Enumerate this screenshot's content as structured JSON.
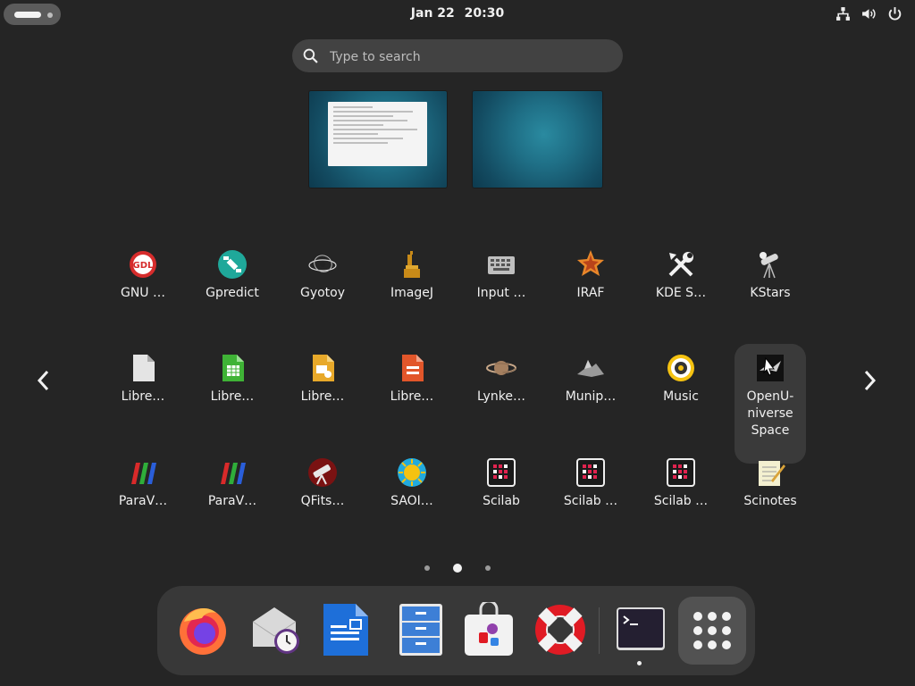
{
  "topbar": {
    "date": "Jan 22",
    "time": "20:30",
    "icons": [
      "network-icon",
      "volume-icon",
      "power-icon"
    ]
  },
  "search": {
    "placeholder": "Type to search"
  },
  "workspaces": [
    "Workspace 1",
    "Workspace 2"
  ],
  "app_grid": {
    "rows": [
      [
        {
          "label": "GNU …",
          "icon": "gdl-icon"
        },
        {
          "label": "Gpredict",
          "icon": "gpredict-icon"
        },
        {
          "label": "Gyotoy",
          "icon": "gyotoy-icon"
        },
        {
          "label": "ImageJ",
          "icon": "imagej-icon"
        },
        {
          "label": "Input …",
          "icon": "keyboard-icon"
        },
        {
          "label": "IRAF",
          "icon": "iraf-icon"
        },
        {
          "label": "KDE S…",
          "icon": "tools-icon"
        },
        {
          "label": "KStars",
          "icon": "telescope-icon"
        }
      ],
      [
        {
          "label": "Libre…",
          "icon": "libreoffice-icon"
        },
        {
          "label": "Libre…",
          "icon": "libreoffice-calc-icon"
        },
        {
          "label": "Libre…",
          "icon": "libreoffice-impress-icon"
        },
        {
          "label": "Libre…",
          "icon": "libreoffice-impress-red-icon"
        },
        {
          "label": "Lynke…",
          "icon": "saturn-icon"
        },
        {
          "label": "Munip…",
          "icon": "munipack-icon"
        },
        {
          "label": "Music",
          "icon": "music-icon"
        },
        {
          "label": "OpenU-niverse Space Simulat…",
          "icon": "openuniverse-icon"
        }
      ],
      [
        {
          "label": "ParaV…",
          "icon": "paraview-icon"
        },
        {
          "label": "ParaV…",
          "icon": "paraview-icon"
        },
        {
          "label": "QFits…",
          "icon": "qfits-icon"
        },
        {
          "label": "SAOI…",
          "icon": "saoimage-icon"
        },
        {
          "label": "Scilab",
          "icon": "scilab-icon"
        },
        {
          "label": "Scilab …",
          "icon": "scilab-icon"
        },
        {
          "label": "Scilab …",
          "icon": "scilab-icon"
        },
        {
          "label": "Scinotes",
          "icon": "scinotes-icon"
        }
      ]
    ],
    "page_count": 3,
    "current_page": 2
  },
  "dash": {
    "apps": [
      {
        "name": "Firefox",
        "icon": "firefox-icon"
      },
      {
        "name": "Evolution",
        "icon": "mail-clock-icon"
      },
      {
        "name": "LibreOffice Writer",
        "icon": "writer-icon"
      },
      {
        "name": "Files",
        "icon": "file-cabinet-icon"
      },
      {
        "name": "Software",
        "icon": "software-bag-icon"
      },
      {
        "name": "Help",
        "icon": "lifebuoy-icon"
      },
      {
        "name": "Terminal",
        "icon": "terminal-icon"
      }
    ],
    "show_apps_icon": "app-grid-icon"
  },
  "colors": {
    "background": "#252525",
    "search": "#424242",
    "dash": "#383838"
  }
}
